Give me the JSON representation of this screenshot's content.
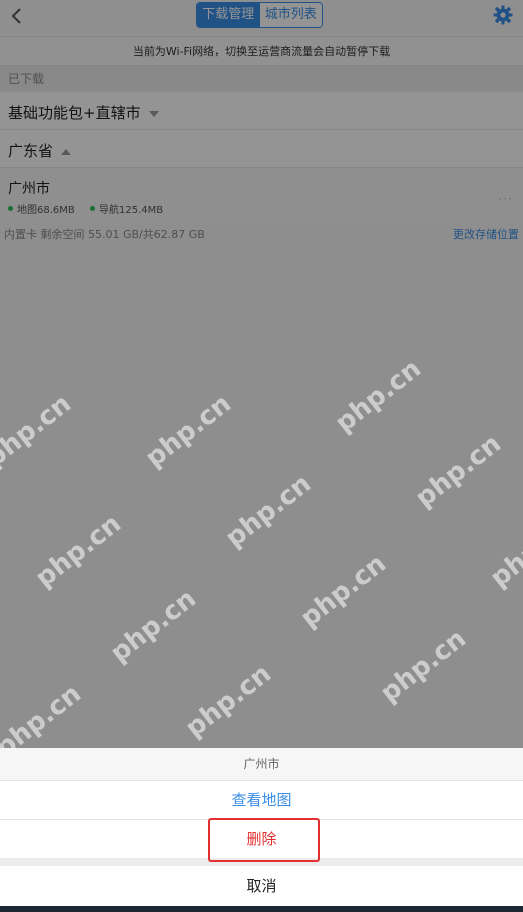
{
  "header": {
    "tab_downloads": "下载管理",
    "tab_cities": "城市列表"
  },
  "notice": "当前为Wi-Fi网络，切换至运营商流量会自动暂停下载",
  "section": {
    "downloaded_label": "已下载"
  },
  "groups": [
    {
      "label": "基础功能包+直辖市"
    },
    {
      "label": "广东省"
    }
  ],
  "city": {
    "name": "广州市",
    "map_size": "地图68.6MB",
    "nav_size": "导航125.4MB",
    "more": "···"
  },
  "storage": {
    "info": "内置卡 剩余空间 55.01 GB/共62.87 GB",
    "change_location": "更改存储位置"
  },
  "watermark_text": "php.cn",
  "action_sheet": {
    "title": "广州市",
    "view_map": "查看地图",
    "delete": "删除",
    "cancel": "取消"
  },
  "colors": {
    "accent": "#3a8ee6",
    "danger": "#e03030",
    "status_green": "#2ebd59"
  }
}
